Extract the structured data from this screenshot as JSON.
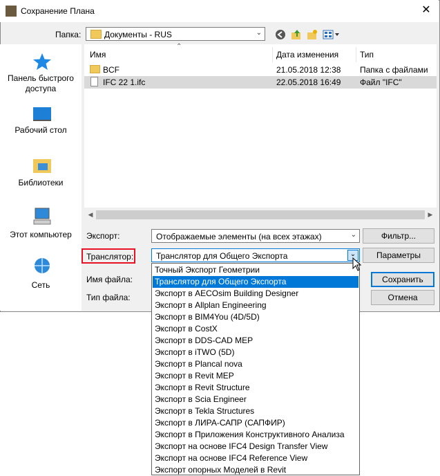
{
  "window": {
    "title": "Сохранение Плана",
    "close_glyph": "✕"
  },
  "toolbar": {
    "folder_label": "Папка:",
    "folder_value": "Документы - RUS",
    "icons": [
      "back-icon",
      "up-folder-icon",
      "new-folder-icon",
      "view-menu-icon"
    ]
  },
  "sidebar": {
    "items": [
      {
        "label": "Панель быстрого доступа",
        "icon": "star-icon"
      },
      {
        "label": "Рабочий стол",
        "icon": "desktop-icon"
      },
      {
        "label": "Библиотеки",
        "icon": "libraries-icon"
      },
      {
        "label": "Этот компьютер",
        "icon": "computer-icon"
      },
      {
        "label": "Сеть",
        "icon": "network-icon"
      }
    ]
  },
  "filelist": {
    "columns": [
      "Имя",
      "Дата изменения",
      "Тип"
    ],
    "rows": [
      {
        "name": "BCF",
        "date": "21.05.2018 12:38",
        "type": "Папка с файлами",
        "kind": "folder",
        "selected": false
      },
      {
        "name": "IFC 22 1.ifc",
        "date": "22.05.2018 16:49",
        "type": "Файл \"IFC\"",
        "kind": "file",
        "selected": true
      }
    ]
  },
  "form": {
    "export_label": "Экспорт:",
    "export_value": "Отображаемые элементы (на всех этажах)",
    "filter_button": "Фильтр...",
    "translator_label": "Транслятор:",
    "translator_value": "Транслятор для Общего Экспорта",
    "params_button": "Параметры",
    "filename_label": "Имя файла:",
    "filetype_label": "Тип файла:",
    "save_button": "Сохранить",
    "cancel_button": "Отмена"
  },
  "dropdown": {
    "selected_index": 1,
    "options": [
      "Точный Экспорт Геометрии",
      "Транслятор для Общего Экспорта",
      "Экспорт в AECOsim Building Designer",
      "Экспорт в Allplan Engineering",
      "Экспорт в BIM4You (4D/5D)",
      "Экспорт в CostX",
      "Экспорт в DDS-CAD MEP",
      "Экспорт в iTWO (5D)",
      "Экспорт в Plancal nova",
      "Экспорт в Revit MEP",
      "Экспорт в Revit Structure",
      "Экспорт в Scia Engineer",
      "Экспорт в Tekla Structures",
      "Экспорт в ЛИРА-САПР (САПФИР)",
      "Экспорт в Приложения Конструктивного Анализа",
      "Экспорт на основе IFC4 Design Transfer View",
      "Экспорт на основе IFC4 Reference View",
      "Экспорт опорных Моделей в Revit"
    ]
  },
  "colors": {
    "selection": "#0078d7",
    "highlight_box": "#e81123",
    "folder": "#f1c85a"
  }
}
